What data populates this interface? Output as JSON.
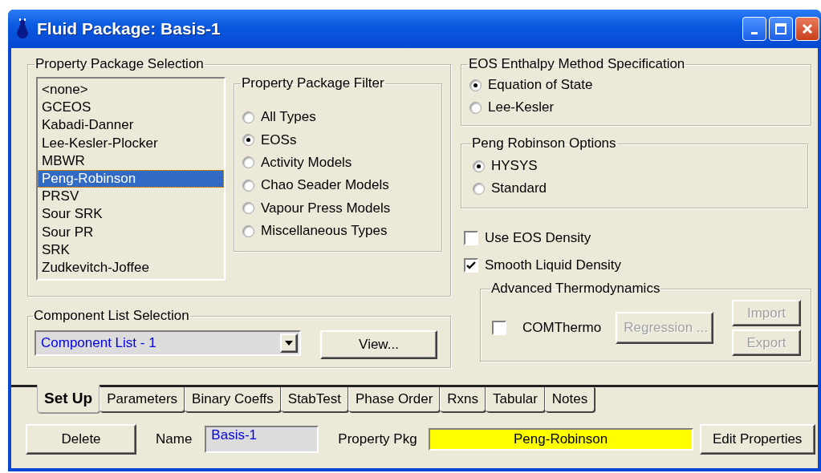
{
  "window": {
    "title": "Fluid Package: Basis-1"
  },
  "property_package_selection": {
    "title": "Property Package Selection",
    "packages": [
      {
        "label": "<none>",
        "selected": false
      },
      {
        "label": "GCEOS",
        "selected": false
      },
      {
        "label": "Kabadi-Danner",
        "selected": false
      },
      {
        "label": "Lee-Kesler-Plocker",
        "selected": false
      },
      {
        "label": "MBWR",
        "selected": false
      },
      {
        "label": "Peng-Robinson",
        "selected": true
      },
      {
        "label": "PRSV",
        "selected": false
      },
      {
        "label": "Sour SRK",
        "selected": false
      },
      {
        "label": "Sour PR",
        "selected": false
      },
      {
        "label": "SRK",
        "selected": false
      },
      {
        "label": "Zudkevitch-Joffee",
        "selected": false
      }
    ],
    "filter": {
      "title": "Property Package Filter",
      "options": [
        {
          "label": "All Types",
          "selected": false
        },
        {
          "label": "EOSs",
          "selected": true
        },
        {
          "label": "Activity Models",
          "selected": false
        },
        {
          "label": "Chao Seader Models",
          "selected": false
        },
        {
          "label": "Vapour Press Models",
          "selected": false
        },
        {
          "label": "Miscellaneous Types",
          "selected": false
        }
      ]
    }
  },
  "component_list_selection": {
    "title": "Component List Selection",
    "value": "Component List - 1",
    "view_button": "View..."
  },
  "eos_enthalpy": {
    "title": "EOS Enthalpy Method Specification",
    "options": [
      {
        "label": "Equation of State",
        "selected": true
      },
      {
        "label": "Lee-Kesler",
        "selected": false
      }
    ]
  },
  "peng_robinson_options": {
    "title": "Peng Robinson Options",
    "options": [
      {
        "label": "HYSYS",
        "selected": true
      },
      {
        "label": "Standard",
        "selected": false
      }
    ]
  },
  "checks": [
    {
      "label": "Use EOS Density",
      "checked": false
    },
    {
      "label": "Smooth Liquid Density",
      "checked": true
    }
  ],
  "advanced_thermodynamics": {
    "title": "Advanced Thermodynamics",
    "comthermo": {
      "label": "COMThermo",
      "checked": false
    },
    "regression": {
      "label": "Regression ...",
      "disabled": true
    },
    "side_buttons": [
      {
        "label": "Import",
        "disabled": true
      },
      {
        "label": "Export",
        "disabled": true
      }
    ]
  },
  "tabs": [
    {
      "label": "Set Up",
      "selected": true
    },
    {
      "label": "Parameters",
      "selected": false
    },
    {
      "label": "Binary Coeffs",
      "selected": false
    },
    {
      "label": "StabTest",
      "selected": false
    },
    {
      "label": "Phase Order",
      "selected": false
    },
    {
      "label": "Rxns",
      "selected": false
    },
    {
      "label": "Tabular",
      "selected": false
    },
    {
      "label": "Notes",
      "selected": false
    }
  ],
  "footer": {
    "delete_button": "Delete",
    "name_label": "Name",
    "name_value": "Basis-1",
    "property_pkg_label": "Property Pkg",
    "property_pkg_value": "Peng-Robinson",
    "edit_button": "Edit Properties"
  }
}
